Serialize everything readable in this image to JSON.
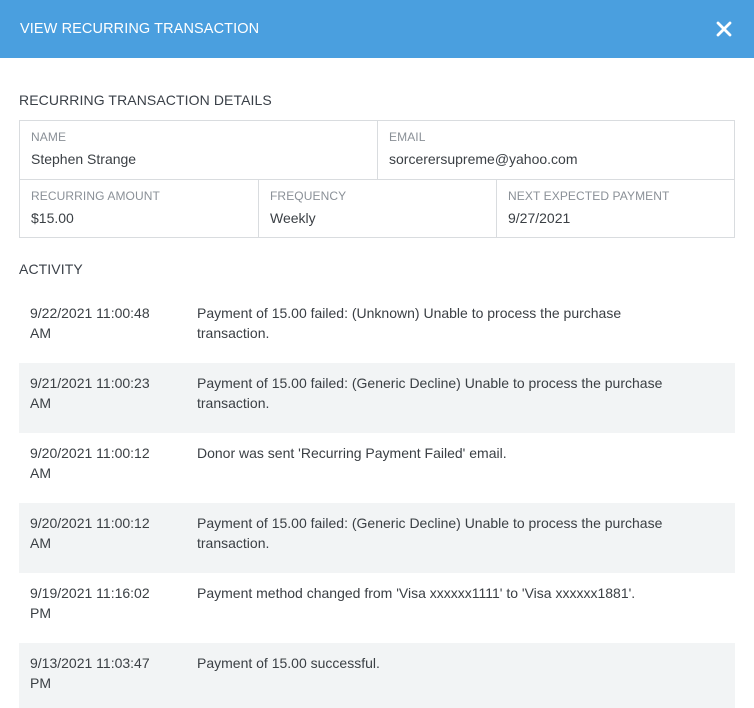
{
  "header": {
    "title": "VIEW RECURRING TRANSACTION"
  },
  "details": {
    "section_title": "RECURRING TRANSACTION DETAILS",
    "name_label": "NAME",
    "name_value": "Stephen Strange",
    "email_label": "EMAIL",
    "email_value": "sorcerersupreme@yahoo.com",
    "amount_label": "RECURRING AMOUNT",
    "amount_value": "$15.00",
    "frequency_label": "FREQUENCY",
    "frequency_value": "Weekly",
    "next_label": "NEXT EXPECTED PAYMENT",
    "next_value": "9/27/2021"
  },
  "activity": {
    "section_title": "ACTIVITY",
    "rows": [
      {
        "date": "9/22/2021 11:00:48",
        "ampm": "AM",
        "text": "Payment of 15.00 failed: (Unknown) Unable to process the purchase transaction."
      },
      {
        "date": "9/21/2021 11:00:23",
        "ampm": "AM",
        "text": "Payment of 15.00 failed: (Generic Decline) Unable to process the purchase transaction."
      },
      {
        "date": "9/20/2021 11:00:12",
        "ampm": "AM",
        "text": "Donor was sent 'Recurring Payment Failed' email."
      },
      {
        "date": "9/20/2021 11:00:12",
        "ampm": "AM",
        "text": "Payment of 15.00 failed: (Generic Decline) Unable to process the purchase transaction."
      },
      {
        "date": "9/19/2021 11:16:02",
        "ampm": "PM",
        "text": "Payment method changed from 'Visa xxxxxx1111' to 'Visa xxxxxx1881'."
      },
      {
        "date": "9/13/2021 11:03:47",
        "ampm": "PM",
        "text": "Payment of 15.00 successful."
      }
    ]
  },
  "colors": {
    "header_bg": "#4a9fdf",
    "row_shade": "#f2f4f5",
    "border": "#d9dcdf"
  },
  "icons": {
    "close": "close-icon"
  }
}
